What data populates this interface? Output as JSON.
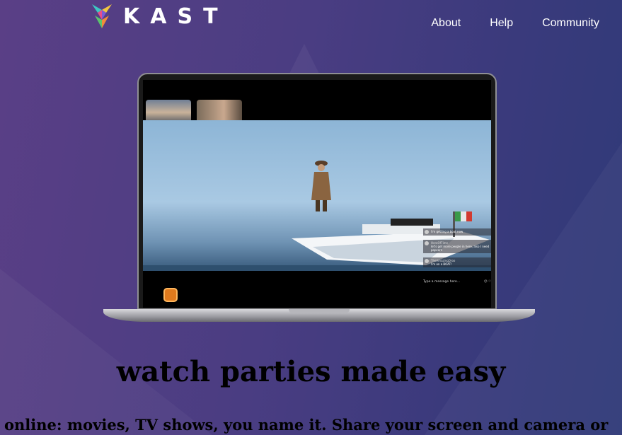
{
  "brand": {
    "name": "KAST",
    "logo_icon": "fox-logo-icon"
  },
  "nav": {
    "items": [
      "About",
      "Help",
      "Community"
    ]
  },
  "hero": {
    "title": "watch parties made easy",
    "subtitle": "online: movies, TV shows, you name it. Share your screen and camera or"
  },
  "chat": {
    "messages": [
      {
        "user": "",
        "text": "I'm getting a boat now"
      },
      {
        "user": "HeroOf7ime",
        "text": "let's get more people in here, also I need popcorn"
      },
      {
        "user": "TheAmazingDroo",
        "text": "I'm on a BOAT!"
      }
    ],
    "input_placeholder": "Type a message here...",
    "input_icons": [
      "smiley-icon",
      "heart-icon"
    ]
  },
  "colors": {
    "background_start": "#5a3f86",
    "background_end": "#2f3a78",
    "nav_text": "#ffffff"
  }
}
